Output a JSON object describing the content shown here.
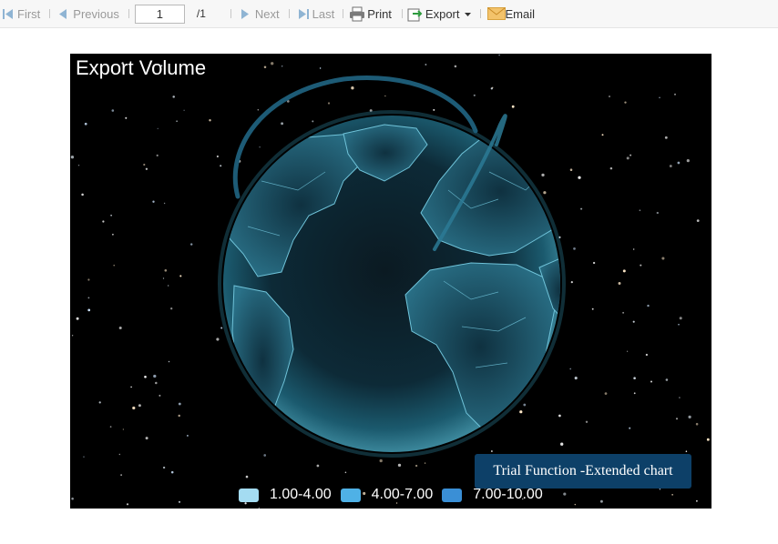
{
  "toolbar": {
    "first_label": "First",
    "previous_label": "Previous",
    "page_value": "1",
    "page_total": "/1",
    "next_label": "Next",
    "last_label": "Last",
    "print_label": "Print",
    "export_label": "Export",
    "email_label": "Email"
  },
  "chart_data": {
    "type": "map",
    "title": "Export Volume",
    "legend": [
      {
        "label": "1.00-4.00",
        "color": "#a4dcf2"
      },
      {
        "label": "4.00-7.00",
        "color": "#4fb1e6"
      },
      {
        "label": "7.00-10.00",
        "color": "#3a8fd6"
      }
    ],
    "watermark": "Trial Function -Extended chart"
  }
}
